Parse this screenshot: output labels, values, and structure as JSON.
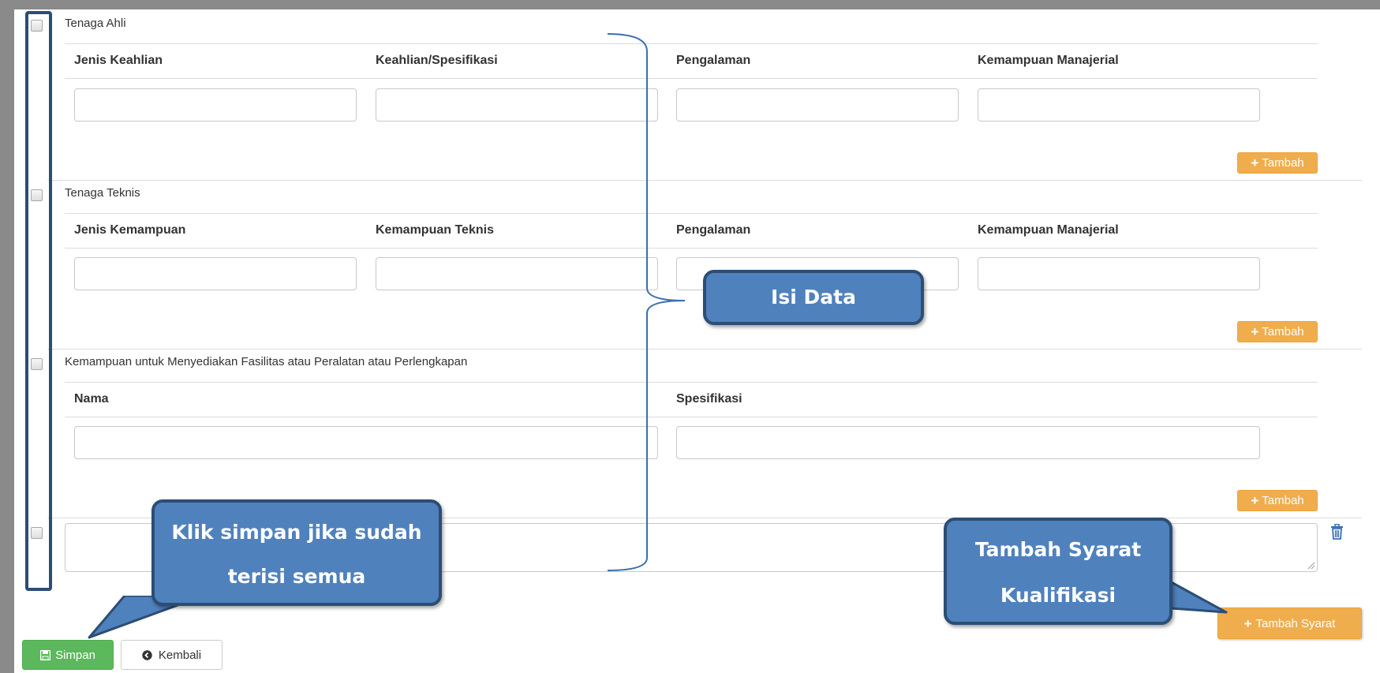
{
  "sections": [
    {
      "title": "Tenaga Ahli",
      "columns": [
        "Jenis Keahlian",
        "Keahlian/Spesifikasi",
        "Pengalaman",
        "Kemampuan Manajerial"
      ],
      "add_label": "Tambah"
    },
    {
      "title": "Tenaga Teknis",
      "columns": [
        "Jenis Kemampuan",
        "Kemampuan Teknis",
        "Pengalaman",
        "Kemampuan Manajerial"
      ],
      "add_label": "Tambah"
    },
    {
      "title": "Kemampuan untuk Menyediakan Fasilitas atau Peralatan atau Perlengkapan",
      "columns": [
        "Nama",
        "Spesifikasi"
      ],
      "add_label": "Tambah"
    }
  ],
  "add_requirement_label": "Tambah Syarat",
  "save_label": "Simpan",
  "back_label": "Kembali",
  "callouts": {
    "fill_data": "Isi Data",
    "save_hint_line1": "Klik simpan jika sudah",
    "save_hint_line2": "terisi semua",
    "add_req_line1": "Tambah Syarat",
    "add_req_line2": "Kualifikasi"
  },
  "colors": {
    "accent_orange": "#f0ad4e",
    "save_green": "#5cb85c",
    "callout_blue": "#4f81bd",
    "callout_border": "#2c4d75"
  },
  "icons": [
    "plus-icon",
    "trash-icon",
    "save-icon",
    "back-arrow-icon"
  ]
}
